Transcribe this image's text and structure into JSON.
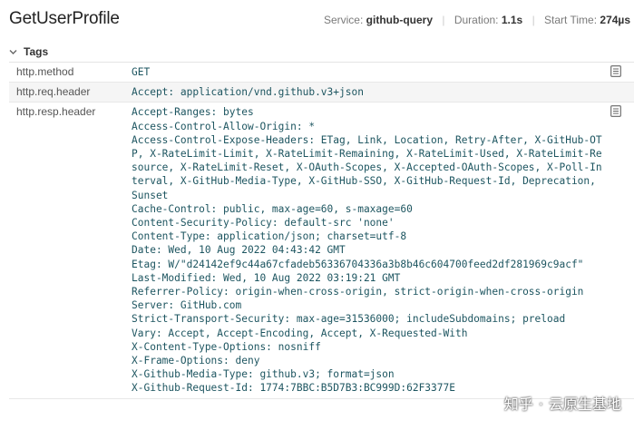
{
  "header": {
    "title": "GetUserProfile",
    "service_label": "Service:",
    "service_value": "github-query",
    "duration_label": "Duration:",
    "duration_value": "1.1s",
    "start_label": "Start Time:",
    "start_value": "274µs"
  },
  "tags": {
    "label": "Tags",
    "rows": [
      {
        "key": "http.method",
        "value": "GET",
        "copy_icon": "copy-icon"
      },
      {
        "key": "http.req.header",
        "value": "Accept: application/vnd.github.v3+json"
      },
      {
        "key": "http.resp.header",
        "value": "Accept-Ranges: bytes\nAccess-Control-Allow-Origin: *\nAccess-Control-Expose-Headers: ETag, Link, Location, Retry-After, X-GitHub-OTP, X-RateLimit-Limit, X-RateLimit-Remaining, X-RateLimit-Used, X-RateLimit-Resource, X-RateLimit-Reset, X-OAuth-Scopes, X-Accepted-OAuth-Scopes, X-Poll-Interval, X-GitHub-Media-Type, X-GitHub-SSO, X-GitHub-Request-Id, Deprecation, Sunset\nCache-Control: public, max-age=60, s-maxage=60\nContent-Security-Policy: default-src 'none'\nContent-Type: application/json; charset=utf-8\nDate: Wed, 10 Aug 2022 04:43:42 GMT\nEtag: W/\"d24142ef9c44a67cfadeb56336704336a3b8b46c604700feed2df281969c9acf\"\nLast-Modified: Wed, 10 Aug 2022 03:19:21 GMT\nReferrer-Policy: origin-when-cross-origin, strict-origin-when-cross-origin\nServer: GitHub.com\nStrict-Transport-Security: max-age=31536000; includeSubdomains; preload\nVary: Accept, Accept-Encoding, Accept, X-Requested-With\nX-Content-Type-Options: nosniff\nX-Frame-Options: deny\nX-Github-Media-Type: github.v3; format=json\nX-Github-Request-Id: 1774:7BBC:B5D7B3:BC999D:62F3377E",
        "copy_icon": "copy-icon"
      }
    ]
  },
  "watermark": {
    "left": "知乎",
    "right": "云原生基地"
  }
}
